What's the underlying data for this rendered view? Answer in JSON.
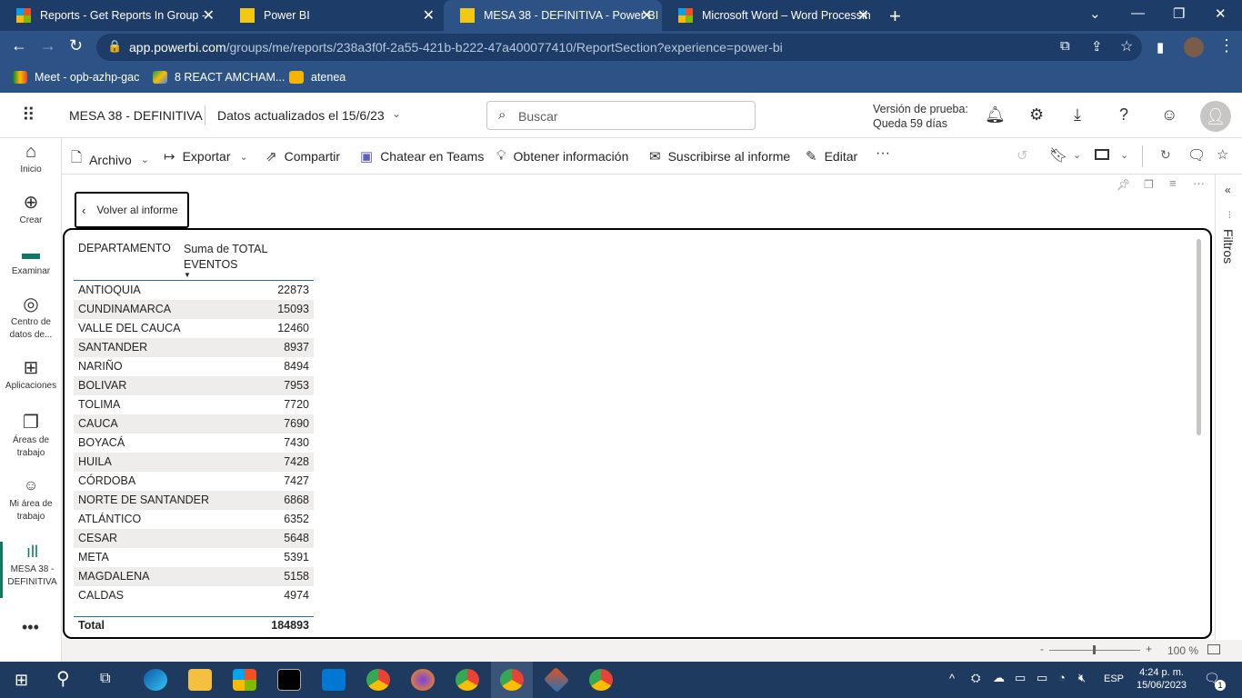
{
  "browser": {
    "tabs": [
      {
        "title": "Reports - Get Reports In Group -",
        "icon": "ms-icon"
      },
      {
        "title": "Power BI",
        "icon": "powerbi-icon"
      },
      {
        "title": "MESA 38 - DEFINITIVA - Power BI",
        "icon": "powerbi-icon"
      },
      {
        "title": "Microsoft Word – Word Processin",
        "icon": "ms-icon"
      }
    ],
    "url_host": "app.powerbi.com",
    "url_path": "/groups/me/reports/238a3f0f-2a55-421b-b222-47a400077410/ReportSection?experience=power-bi",
    "bookmarks": [
      "Meet - opb-azhp-gac",
      "8 REACT AMCHAM...",
      "atenea"
    ]
  },
  "header": {
    "report_name": "MESA 38 - DEFINITIVA",
    "data_updated": "Datos actualizados el 15/6/23",
    "search_placeholder": "Buscar",
    "trial_line1": "Versión de prueba:",
    "trial_line2": "Queda 59 días"
  },
  "leftnav": [
    {
      "label": "Inicio",
      "icon": "home-icon"
    },
    {
      "label": "Crear",
      "icon": "plus-circle-icon"
    },
    {
      "label": "Examinar",
      "icon": "folder-icon"
    },
    {
      "label": "Centro de datos de...",
      "icon": "datahub-icon"
    },
    {
      "label": "Aplicaciones",
      "icon": "apps-icon"
    },
    {
      "label": "Áreas de trabajo",
      "icon": "workspaces-icon"
    },
    {
      "label": "Mi área de trabajo",
      "icon": "person-icon"
    },
    {
      "label": "MESA 38 - DEFINITIVA",
      "icon": "report-icon"
    }
  ],
  "toolbar": {
    "archivo": "Archivo",
    "exportar": "Exportar",
    "compartir": "Compartir",
    "teams": "Chatear en Teams",
    "info": "Obtener información",
    "suscribirse": "Suscribirse al informe",
    "editar": "Editar"
  },
  "canvas": {
    "back_label": "Volver al informe",
    "filters_label": "Filtros"
  },
  "table": {
    "col1": "DEPARTAMENTO",
    "col2": "Suma de TOTAL EVENTOS",
    "rows": [
      {
        "dep": "ANTIOQUIA",
        "val": "22873"
      },
      {
        "dep": "CUNDINAMARCA",
        "val": "15093"
      },
      {
        "dep": "VALLE DEL CAUCA",
        "val": "12460"
      },
      {
        "dep": "SANTANDER",
        "val": "8937"
      },
      {
        "dep": "NARIÑO",
        "val": "8494"
      },
      {
        "dep": "BOLIVAR",
        "val": "7953"
      },
      {
        "dep": "TOLIMA",
        "val": "7720"
      },
      {
        "dep": "CAUCA",
        "val": "7690"
      },
      {
        "dep": "BOYACÁ",
        "val": "7430"
      },
      {
        "dep": "HUILA",
        "val": "7428"
      },
      {
        "dep": "CÓRDOBA",
        "val": "7427"
      },
      {
        "dep": "NORTE DE SANTANDER",
        "val": "6868"
      },
      {
        "dep": "ATLÁNTICO",
        "val": "6352"
      },
      {
        "dep": "CESAR",
        "val": "5648"
      },
      {
        "dep": "META",
        "val": "5391"
      },
      {
        "dep": "MAGDALENA",
        "val": "5158"
      },
      {
        "dep": "CALDAS",
        "val": "4974"
      }
    ],
    "total_label": "Total",
    "total_value": "184893"
  },
  "statusbar": {
    "zoom": "100 %"
  },
  "taskbar": {
    "time": "4:24 p. m.",
    "date": "15/06/2023",
    "lang": "ESP",
    "notif": "1"
  }
}
